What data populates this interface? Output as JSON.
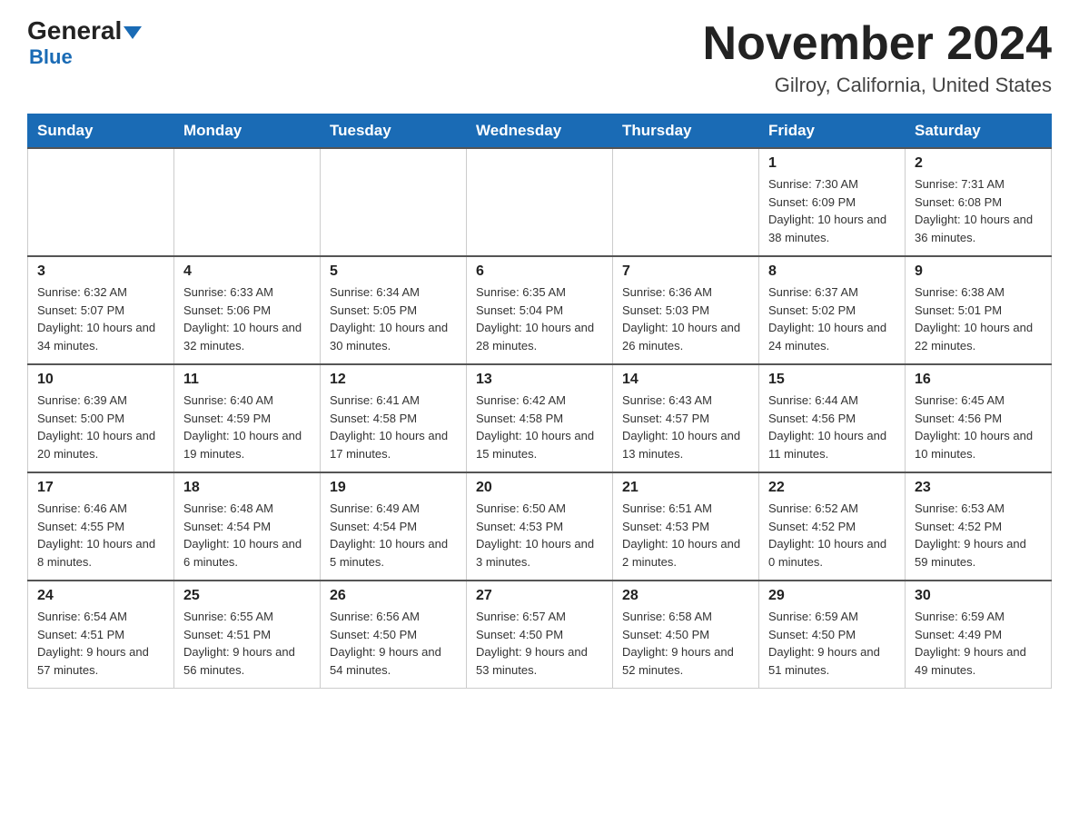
{
  "header": {
    "logo_general": "General",
    "logo_blue": "Blue",
    "main_title": "November 2024",
    "subtitle": "Gilroy, California, United States"
  },
  "days_of_week": [
    "Sunday",
    "Monday",
    "Tuesday",
    "Wednesday",
    "Thursday",
    "Friday",
    "Saturday"
  ],
  "weeks": [
    [
      {
        "day": "",
        "info": ""
      },
      {
        "day": "",
        "info": ""
      },
      {
        "day": "",
        "info": ""
      },
      {
        "day": "",
        "info": ""
      },
      {
        "day": "",
        "info": ""
      },
      {
        "day": "1",
        "info": "Sunrise: 7:30 AM\nSunset: 6:09 PM\nDaylight: 10 hours and 38 minutes."
      },
      {
        "day": "2",
        "info": "Sunrise: 7:31 AM\nSunset: 6:08 PM\nDaylight: 10 hours and 36 minutes."
      }
    ],
    [
      {
        "day": "3",
        "info": "Sunrise: 6:32 AM\nSunset: 5:07 PM\nDaylight: 10 hours and 34 minutes."
      },
      {
        "day": "4",
        "info": "Sunrise: 6:33 AM\nSunset: 5:06 PM\nDaylight: 10 hours and 32 minutes."
      },
      {
        "day": "5",
        "info": "Sunrise: 6:34 AM\nSunset: 5:05 PM\nDaylight: 10 hours and 30 minutes."
      },
      {
        "day": "6",
        "info": "Sunrise: 6:35 AM\nSunset: 5:04 PM\nDaylight: 10 hours and 28 minutes."
      },
      {
        "day": "7",
        "info": "Sunrise: 6:36 AM\nSunset: 5:03 PM\nDaylight: 10 hours and 26 minutes."
      },
      {
        "day": "8",
        "info": "Sunrise: 6:37 AM\nSunset: 5:02 PM\nDaylight: 10 hours and 24 minutes."
      },
      {
        "day": "9",
        "info": "Sunrise: 6:38 AM\nSunset: 5:01 PM\nDaylight: 10 hours and 22 minutes."
      }
    ],
    [
      {
        "day": "10",
        "info": "Sunrise: 6:39 AM\nSunset: 5:00 PM\nDaylight: 10 hours and 20 minutes."
      },
      {
        "day": "11",
        "info": "Sunrise: 6:40 AM\nSunset: 4:59 PM\nDaylight: 10 hours and 19 minutes."
      },
      {
        "day": "12",
        "info": "Sunrise: 6:41 AM\nSunset: 4:58 PM\nDaylight: 10 hours and 17 minutes."
      },
      {
        "day": "13",
        "info": "Sunrise: 6:42 AM\nSunset: 4:58 PM\nDaylight: 10 hours and 15 minutes."
      },
      {
        "day": "14",
        "info": "Sunrise: 6:43 AM\nSunset: 4:57 PM\nDaylight: 10 hours and 13 minutes."
      },
      {
        "day": "15",
        "info": "Sunrise: 6:44 AM\nSunset: 4:56 PM\nDaylight: 10 hours and 11 minutes."
      },
      {
        "day": "16",
        "info": "Sunrise: 6:45 AM\nSunset: 4:56 PM\nDaylight: 10 hours and 10 minutes."
      }
    ],
    [
      {
        "day": "17",
        "info": "Sunrise: 6:46 AM\nSunset: 4:55 PM\nDaylight: 10 hours and 8 minutes."
      },
      {
        "day": "18",
        "info": "Sunrise: 6:48 AM\nSunset: 4:54 PM\nDaylight: 10 hours and 6 minutes."
      },
      {
        "day": "19",
        "info": "Sunrise: 6:49 AM\nSunset: 4:54 PM\nDaylight: 10 hours and 5 minutes."
      },
      {
        "day": "20",
        "info": "Sunrise: 6:50 AM\nSunset: 4:53 PM\nDaylight: 10 hours and 3 minutes."
      },
      {
        "day": "21",
        "info": "Sunrise: 6:51 AM\nSunset: 4:53 PM\nDaylight: 10 hours and 2 minutes."
      },
      {
        "day": "22",
        "info": "Sunrise: 6:52 AM\nSunset: 4:52 PM\nDaylight: 10 hours and 0 minutes."
      },
      {
        "day": "23",
        "info": "Sunrise: 6:53 AM\nSunset: 4:52 PM\nDaylight: 9 hours and 59 minutes."
      }
    ],
    [
      {
        "day": "24",
        "info": "Sunrise: 6:54 AM\nSunset: 4:51 PM\nDaylight: 9 hours and 57 minutes."
      },
      {
        "day": "25",
        "info": "Sunrise: 6:55 AM\nSunset: 4:51 PM\nDaylight: 9 hours and 56 minutes."
      },
      {
        "day": "26",
        "info": "Sunrise: 6:56 AM\nSunset: 4:50 PM\nDaylight: 9 hours and 54 minutes."
      },
      {
        "day": "27",
        "info": "Sunrise: 6:57 AM\nSunset: 4:50 PM\nDaylight: 9 hours and 53 minutes."
      },
      {
        "day": "28",
        "info": "Sunrise: 6:58 AM\nSunset: 4:50 PM\nDaylight: 9 hours and 52 minutes."
      },
      {
        "day": "29",
        "info": "Sunrise: 6:59 AM\nSunset: 4:50 PM\nDaylight: 9 hours and 51 minutes."
      },
      {
        "day": "30",
        "info": "Sunrise: 6:59 AM\nSunset: 4:49 PM\nDaylight: 9 hours and 49 minutes."
      }
    ]
  ]
}
